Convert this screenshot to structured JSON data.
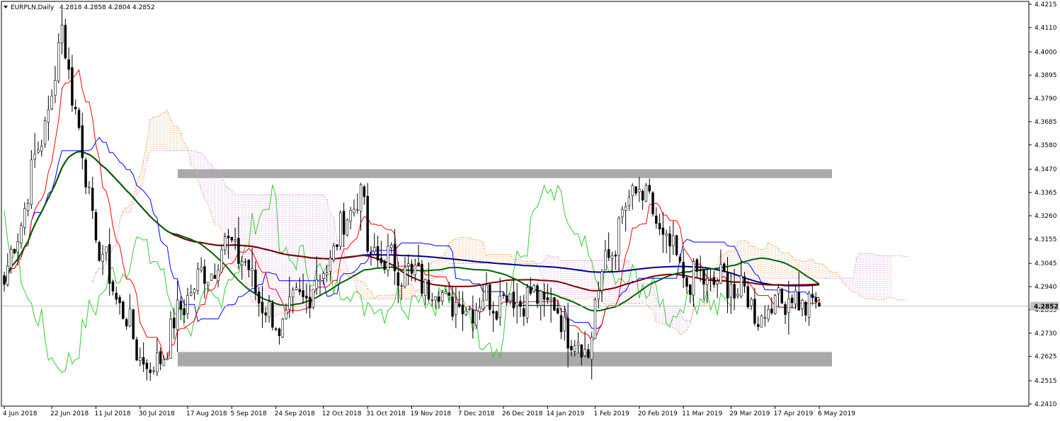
{
  "chart_data": {
    "type": "candlestick",
    "symbol": "EURPLN",
    "timeframe": "Daily",
    "title": "EURPLN,Daily",
    "ohlc_header": [
      "4.2818",
      "4.2858",
      "4.2804",
      "4.2852"
    ],
    "current_price": "4.2852",
    "ylim": [
      4.241,
      4.4215
    ],
    "y_ticks": [
      "4.4215",
      "4.4110",
      "4.4000",
      "4.3895",
      "4.3790",
      "4.3685",
      "4.3580",
      "4.3470",
      "4.3365",
      "4.3260",
      "4.3155",
      "4.3045",
      "4.2940",
      "4.2835",
      "4.2730",
      "4.2625",
      "4.2515",
      "4.2410"
    ],
    "x_ticks": [
      "4 Jun 2018",
      "22 Jun 2018",
      "11 Jul 2018",
      "30 Jul 2018",
      "17 Aug 2018",
      "5 Sep 2018",
      "24 Sep 2018",
      "12 Oct 2018",
      "31 Oct 2018",
      "19 Nov 2018",
      "7 Dec 2018",
      "26 Dec 2018",
      "14 Jan 2019",
      "1 Feb 2019",
      "20 Feb 2019",
      "11 Mar 2019",
      "29 Mar 2019",
      "17 Apr 2019",
      "6 May 2019"
    ],
    "resistance_zone": {
      "from": 4.343,
      "to": 4.347
    },
    "support_zone": {
      "from": 4.258,
      "to": 4.2645
    },
    "key_points": [
      {
        "date": "4 Jun 2018",
        "close": 4.295
      },
      {
        "date": "22 Jun 2018",
        "close": 4.38
      },
      {
        "date": "27 Jun 2018",
        "close": 4.412
      },
      {
        "date": "11 Jul 2018",
        "close": 4.315
      },
      {
        "date": "30 Jul 2018",
        "close": 4.262
      },
      {
        "date": "3 Aug 2018",
        "close": 4.256
      },
      {
        "date": "17 Aug 2018",
        "close": 4.29
      },
      {
        "date": "5 Sep 2018",
        "close": 4.315
      },
      {
        "date": "24 Sep 2018",
        "close": 4.275
      },
      {
        "date": "12 Oct 2018",
        "close": 4.3
      },
      {
        "date": "29 Oct 2018",
        "close": 4.34
      },
      {
        "date": "31 Oct 2018",
        "close": 4.31
      },
      {
        "date": "19 Nov 2018",
        "close": 4.3
      },
      {
        "date": "7 Dec 2018",
        "close": 4.285
      },
      {
        "date": "26 Dec 2018",
        "close": 4.29
      },
      {
        "date": "14 Jan 2019",
        "close": 4.288
      },
      {
        "date": "30 Jan 2019",
        "close": 4.262
      },
      {
        "date": "1 Feb 2019",
        "close": 4.288
      },
      {
        "date": "14 Feb 2019",
        "close": 4.33
      },
      {
        "date": "20 Feb 2019",
        "close": 4.338
      },
      {
        "date": "11 Mar 2019",
        "close": 4.298
      },
      {
        "date": "29 Mar 2019",
        "close": 4.295
      },
      {
        "date": "12 Apr 2019",
        "close": 4.28
      },
      {
        "date": "17 Apr 2019",
        "close": 4.29
      },
      {
        "date": "6 May 2019",
        "close": 4.2852
      }
    ],
    "grid": false,
    "indicators": [
      "ichimoku",
      "moving averages",
      "oscillator overlay"
    ],
    "colors": {
      "bull": "#ffffff",
      "bear": "#000000",
      "ma_green": "#006400",
      "ma_maroon": "#800000",
      "ma_navy": "#00008b",
      "tenkan": "#ff0000",
      "kijun": "#0000ff",
      "chikou": "#32cd32",
      "cloud_up": "#f4a460",
      "cloud_down": "#dda0dd",
      "zone": "#a9a9a9",
      "price_line": "#c0c0c0"
    }
  }
}
